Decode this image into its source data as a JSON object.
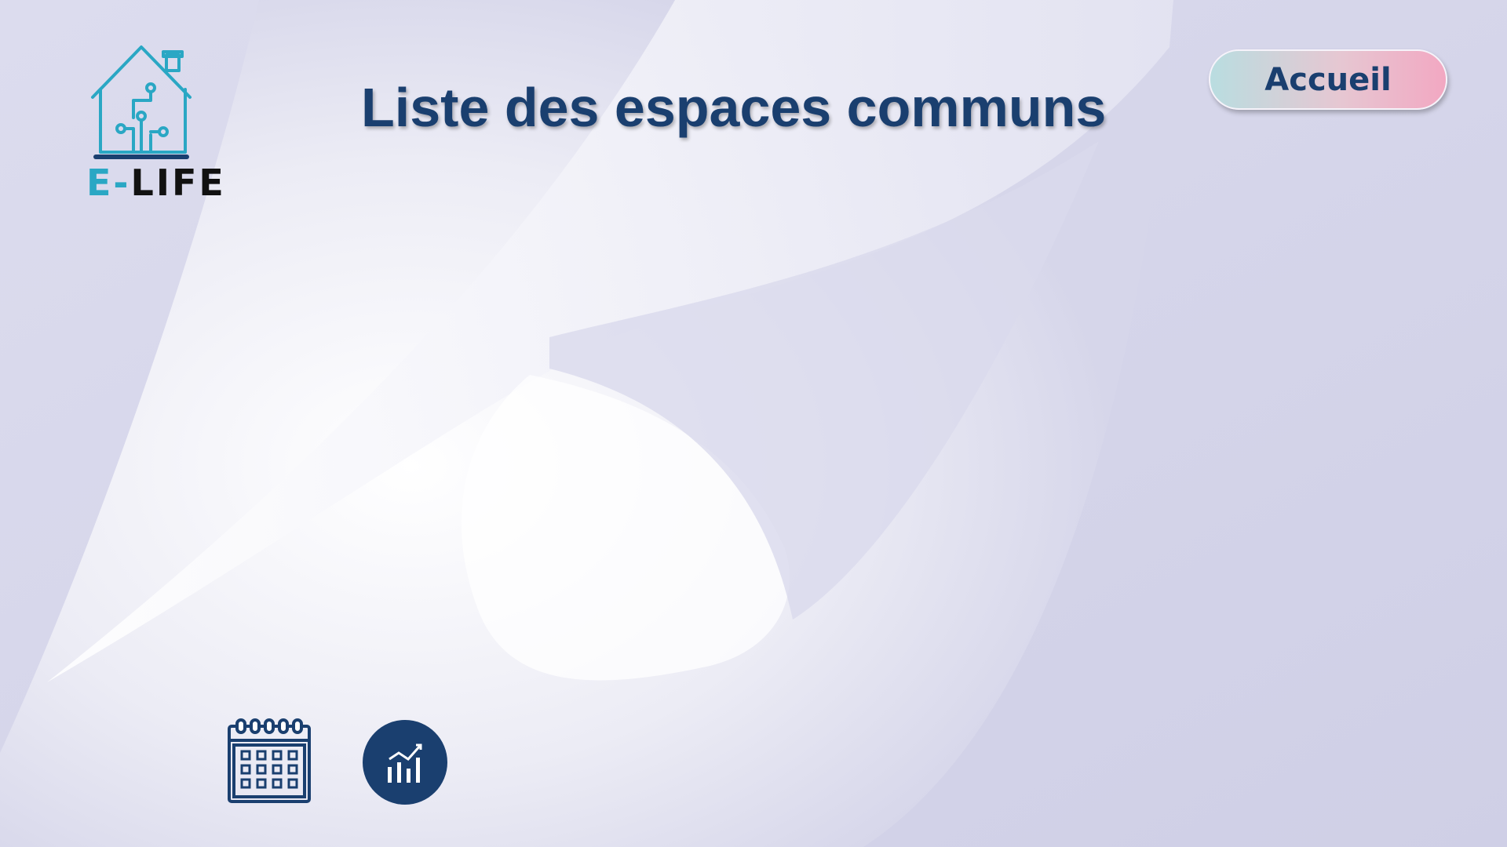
{
  "app": {
    "brand_prefix": "E-",
    "brand_name": "LIFE"
  },
  "header": {
    "title": "Liste des espaces communs"
  },
  "nav": {
    "home_label": "Accueil"
  },
  "toolbar": {
    "calendar_icon": "calendar-icon",
    "stats_icon": "bar-chart-icon"
  },
  "colors": {
    "primary": "#1a3f6f",
    "logo_teal": "#2aa7c4",
    "background": "#d3d3e8"
  }
}
